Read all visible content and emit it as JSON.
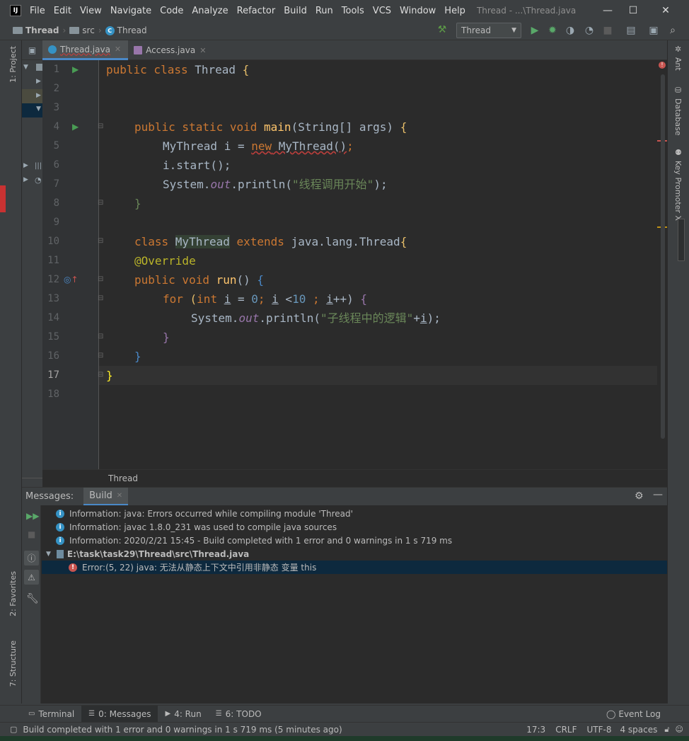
{
  "window": {
    "app_letter": "IJ",
    "title": "Thread - ...\\Thread.java",
    "controls": {
      "minimize": "—",
      "maximize": "☐",
      "close": "✕"
    }
  },
  "menu": [
    "File",
    "Edit",
    "View",
    "Navigate",
    "Code",
    "Analyze",
    "Refactor",
    "Build",
    "Run",
    "Tools",
    "VCS",
    "Window",
    "Help"
  ],
  "navbar": {
    "crumbs": [
      {
        "label": "Thread"
      },
      {
        "label": "src"
      },
      {
        "label": "Thread"
      }
    ],
    "run_config": "Thread"
  },
  "left_stripe": {
    "project": "1: Project",
    "favorites": "2: Favorites",
    "structure": "7: Structure"
  },
  "right_stripe": {
    "ant": "Ant",
    "database": "Database",
    "key_promoter": "Key Promoter X"
  },
  "tabs": [
    {
      "label": "Thread.java",
      "active": true
    },
    {
      "label": "Access.java",
      "active": false
    }
  ],
  "editor": {
    "line_numbers": [
      "1",
      "2",
      "3",
      "4",
      "5",
      "6",
      "7",
      "8",
      "9",
      "10",
      "11",
      "12",
      "13",
      "14",
      "15",
      "16",
      "17",
      "18"
    ],
    "current_line": "17",
    "breadcrumb": "Thread"
  },
  "code": {
    "l1_kw": "public class ",
    "l1_name": "Thread ",
    "l1_brace": "{",
    "l4_kw": "public static void ",
    "l4_fn": "main",
    "l4_rest": "(String[] args) ",
    "l4_brace": "{",
    "l5_a": "MyThread i = ",
    "l5_new": "new",
    "l5_b": " MyThread()",
    "l5_c": ";",
    "l6": "i.start();",
    "l7_a": "System.",
    "l7_out": "out",
    "l7_b": ".println(",
    "l7_str": "\"线程调用开始\"",
    "l7_c": ");",
    "l8": "}",
    "l10_kw": "class ",
    "l10_name": "MyThread",
    "l10_kw2": " extends ",
    "l10_rest": "java.lang.Thread",
    "l10_brace": "{",
    "l11": "@Override",
    "l12_kw": "public void ",
    "l12_fn": "run",
    "l12_rest": "() ",
    "l12_brace": "{",
    "l13_kw": "for ",
    "l13_a": "(",
    "l13_int": "int ",
    "l13_i": "i",
    "l13_b": " = ",
    "l13_0": "0",
    "l13_c": "; ",
    "l13_i2": "i",
    "l13_d": " <",
    "l13_10": "10",
    "l13_e": " ; ",
    "l13_i3": "i",
    "l13_f": "++) ",
    "l13_brace": "{",
    "l14_a": "System.",
    "l14_out": "out",
    "l14_b": ".println(",
    "l14_str": "\"子线程中的逻辑\"",
    "l14_c": "+",
    "l14_i": "i",
    "l14_d": ");",
    "l15": "}",
    "l16": "}",
    "l17": "}"
  },
  "messages": {
    "label": "Messages:",
    "tab": "Build",
    "rows": [
      {
        "type": "info",
        "text": "Information: java: Errors occurred while compiling module 'Thread'"
      },
      {
        "type": "info",
        "text": "Information: javac 1.8.0_231 was used to compile java sources"
      },
      {
        "type": "info",
        "text": "Information: 2020/2/21 15:45 - Build completed with 1 error and 0 warnings in 1 s 719 ms"
      },
      {
        "type": "file",
        "text": "E:\\task\\task29\\Thread\\src\\Thread.java"
      },
      {
        "type": "error",
        "text": "Error:(5, 22)  java: 无法从静态上下文中引用非静态 变量 this"
      }
    ]
  },
  "bottom_tabs": [
    {
      "label": "Terminal"
    },
    {
      "label": "0: Messages",
      "active": true
    },
    {
      "label": "4: Run"
    },
    {
      "label": "6: TODO"
    }
  ],
  "event_log": "Event Log",
  "status": {
    "message": "Build completed with 1 error and 0 warnings in 1 s 719 ms (5 minutes ago)",
    "position": "17:3",
    "line_sep": "CRLF",
    "encoding": "UTF-8",
    "indent": "4 spaces"
  },
  "colors": {
    "keyword": "#cc7832",
    "string": "#6a8759",
    "number": "#6897bb",
    "annotation": "#bbb529",
    "function": "#ffc66d",
    "field": "#9876aa",
    "accent": "#4a88c7",
    "error": "#c75450"
  }
}
